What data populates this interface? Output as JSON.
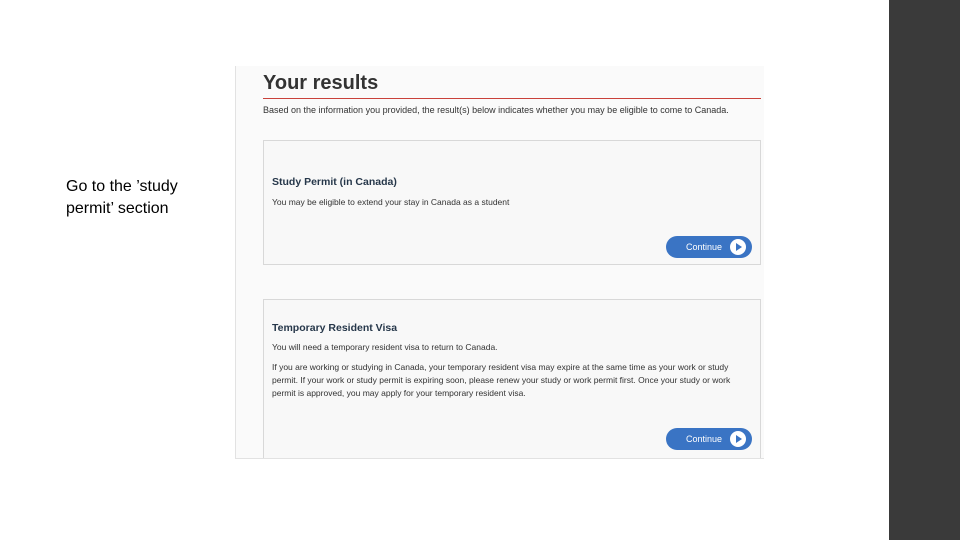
{
  "caption": "Go to the ’study\npermit’  section",
  "results": {
    "title": "Your results",
    "intro": "Based on the information you provided, the result(s) below indicates whether you may be eligible to come to Canada."
  },
  "cards": [
    {
      "title": "Study Permit (in Canada)",
      "text": "You may be eligible to extend your stay in Canada as a student",
      "button_label": "Continue"
    },
    {
      "title": "Temporary Resident Visa",
      "text": "You will need a temporary resident visa to return to Canada.",
      "text2": "If you are working or studying in Canada, your temporary resident visa may expire at the same time as your work or study permit. If your work or study permit is expiring soon, please renew your study or work permit first. Once your study or work permit is approved, you may apply for your temporary resident visa.",
      "button_label": "Continue"
    }
  ],
  "icons": {
    "continue": "play-circle-icon"
  },
  "colors": {
    "accent": "#3a74c4",
    "rule": "#c9413a",
    "heading": "#26374a",
    "dark_bar": "#3a3a3a"
  }
}
